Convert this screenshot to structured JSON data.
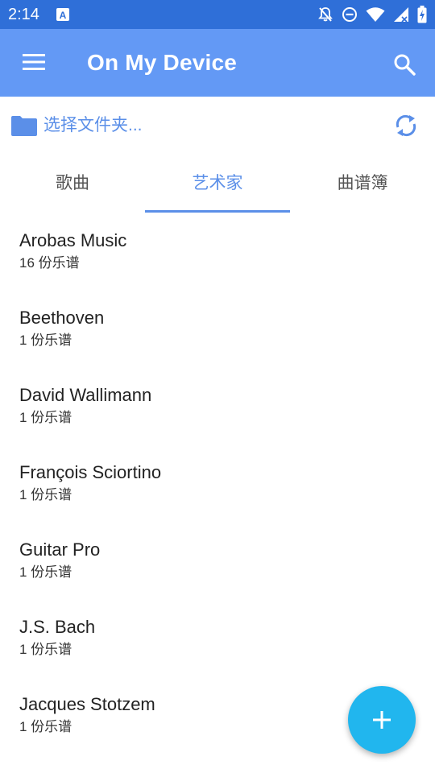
{
  "status_bar": {
    "time": "2:14",
    "left_icon": "app-notification-icon",
    "right_icons": [
      "notifications-off-icon",
      "do-not-disturb-icon",
      "wifi-icon",
      "signal-icon",
      "battery-charging-icon"
    ]
  },
  "app_bar": {
    "title": "On My Device",
    "menu_icon": "menu-icon",
    "search_icon": "search-icon",
    "background": "#6399f5"
  },
  "folder": {
    "label": "选择文件夹...",
    "icon": "folder-icon",
    "refresh_icon": "refresh-icon"
  },
  "tabs": [
    {
      "label": "歌曲",
      "selected": false
    },
    {
      "label": "艺术家",
      "selected": true
    },
    {
      "label": "曲谱簿",
      "selected": false
    }
  ],
  "artists": [
    {
      "name": "Arobas Music",
      "count": "16 份乐谱"
    },
    {
      "name": "Beethoven",
      "count": "1 份乐谱"
    },
    {
      "name": "David Wallimann",
      "count": "1 份乐谱"
    },
    {
      "name": "François Sciortino",
      "count": "1 份乐谱"
    },
    {
      "name": "Guitar Pro",
      "count": "1 份乐谱"
    },
    {
      "name": "J.S. Bach",
      "count": "1 份乐谱"
    },
    {
      "name": "Jacques Stotzem",
      "count": "1 份乐谱"
    }
  ],
  "fab": {
    "icon": "add-icon",
    "color": "#21b6ee"
  },
  "colors": {
    "accent": "#5b8fe8",
    "status_bar": "#2f6fd8"
  }
}
